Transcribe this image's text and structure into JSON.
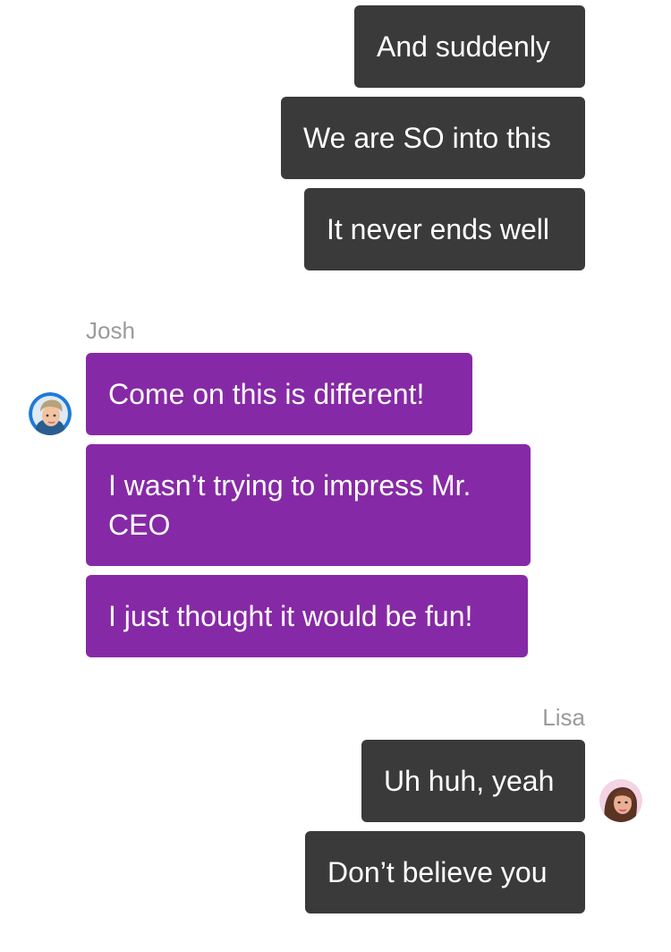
{
  "conversation": {
    "outgoing_group_1": {
      "messages": [
        "And suddenly",
        "We are SO into this",
        "It never ends well"
      ]
    },
    "josh": {
      "name": "Josh",
      "avatar_icon": "josh-avatar-icon",
      "bubble_color": "#8629a6",
      "messages": [
        "Come on this is different!",
        "I wasn’t trying to impress Mr. CEO",
        "I just thought it would be fun!"
      ]
    },
    "lisa": {
      "name": "Lisa",
      "avatar_icon": "lisa-avatar-icon",
      "bubble_color": "#3a3a3a",
      "messages": [
        "Uh huh, yeah",
        "Don’t believe you"
      ]
    }
  }
}
